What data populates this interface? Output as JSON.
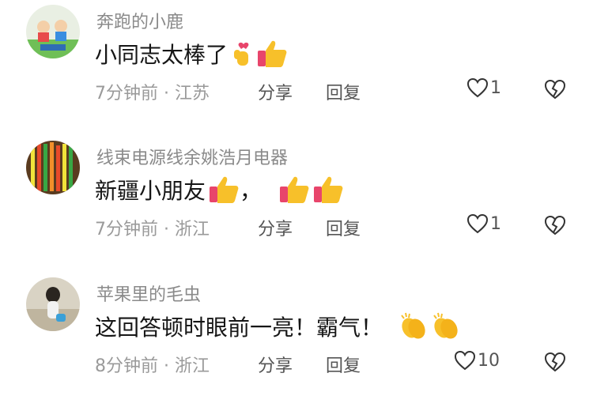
{
  "comments": [
    {
      "username": "奔跑的小鹿",
      "text": "小同志太棒了",
      "time": "7分钟前",
      "location": "江苏",
      "reply_label": "分享",
      "share_label": "回复",
      "likes": "1",
      "emojis": [
        "finger-heart-emoji",
        "thumbs-up-emoji"
      ]
    },
    {
      "username": "线束电源线余姚浩月电器",
      "text": "新疆小朋友",
      "text_suffix": "，",
      "time": "7分钟前",
      "location": "浙江",
      "reply_label": "分享",
      "share_label": "回复",
      "likes": "1",
      "emojis": [
        "thumbs-up-emoji",
        "thumbs-up-emoji",
        "thumbs-up-emoji"
      ]
    },
    {
      "username": "苹果里的毛虫",
      "text": "这回答顿时眼前一亮！霸气！",
      "time": "8分钟前",
      "location": "浙江",
      "reply_label": "分享",
      "share_label": "回复",
      "likes": "10",
      "emojis": [
        "clapping-hands-emoji",
        "clapping-hands-emoji"
      ]
    }
  ],
  "colors": {
    "username": "#8a8a8a",
    "text": "#161616",
    "meta": "#9a9a9a",
    "emoji_yellow": "#f7c02a",
    "heart_pink": "#e8456b"
  }
}
